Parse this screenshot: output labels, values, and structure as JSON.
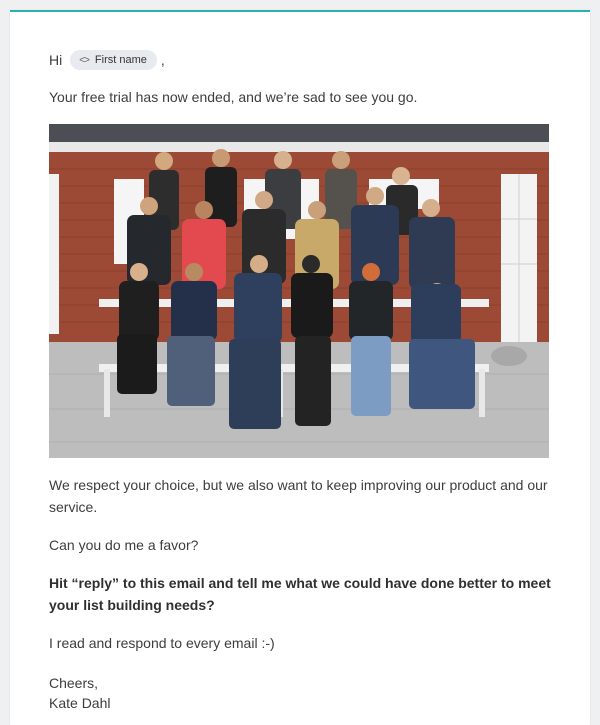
{
  "email": {
    "greeting_prefix": "Hi",
    "merge_tag": {
      "icon": "code-icon",
      "label": "First name"
    },
    "greeting_suffix": ",",
    "intro": "Your free trial has now ended, and we’re sad to see you go.",
    "photo": {
      "subject": "group-photo-people-heads-bowed"
    },
    "respect": "We respect your choice, but we also want to keep improving our product and our service.",
    "favor": "Can you do me a favor?",
    "request": "Hit “reply” to this email and tell me what we could have done better to meet your list building needs?",
    "respond": "I read and respond to every email :-)",
    "signoff": "Cheers,",
    "signature": "Kate Dahl"
  },
  "colors": {
    "accent_line": "#2ab3ad",
    "text": "#3d3d3d",
    "tag_bg": "#e7eaee"
  }
}
